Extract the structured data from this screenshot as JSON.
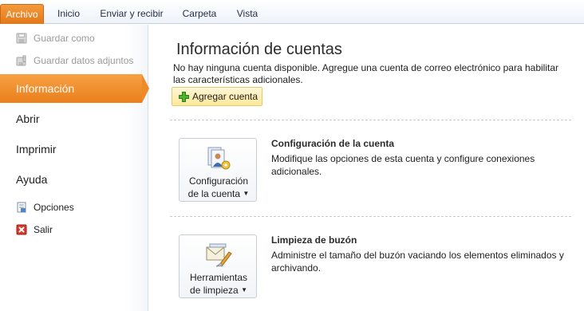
{
  "tabs": {
    "file": "Archivo",
    "home": "Inicio",
    "send_receive": "Enviar y recibir",
    "folder": "Carpeta",
    "view": "Vista"
  },
  "backstage": {
    "save_as": "Guardar como",
    "save_attachments": "Guardar datos adjuntos",
    "info": "Información",
    "open": "Abrir",
    "print": "Imprimir",
    "help": "Ayuda",
    "options": "Opciones",
    "exit": "Salir"
  },
  "main": {
    "title": "Información de cuentas",
    "description": "No hay ninguna cuenta disponible. Agregue una cuenta de correo electrónico para habilitar las características adicionales.",
    "add_account": "Agregar cuenta",
    "account_settings": {
      "button_line1": "Configuración",
      "button_line2": "de la cuenta",
      "title": "Configuración de la cuenta",
      "description": "Modifique las opciones de esta cuenta y configure conexiones adicionales."
    },
    "cleanup": {
      "button_line1": "Herramientas",
      "button_line2": "de limpieza",
      "title": "Limpieza de buzón",
      "description": "Administre el tamaño del buzón vaciando los elementos eliminados y archivando."
    }
  },
  "colors": {
    "accent_orange": "#ea7f1c",
    "button_highlight": "#fde89a",
    "tabbar_border": "#c5d2e3"
  },
  "icons": {
    "save_as": "save-as-icon",
    "save_attachments": "save-attachments-icon",
    "options": "options-icon",
    "exit": "exit-icon",
    "add": "plus-icon",
    "account_settings": "account-settings-icon",
    "cleanup": "mailbox-cleanup-icon"
  }
}
